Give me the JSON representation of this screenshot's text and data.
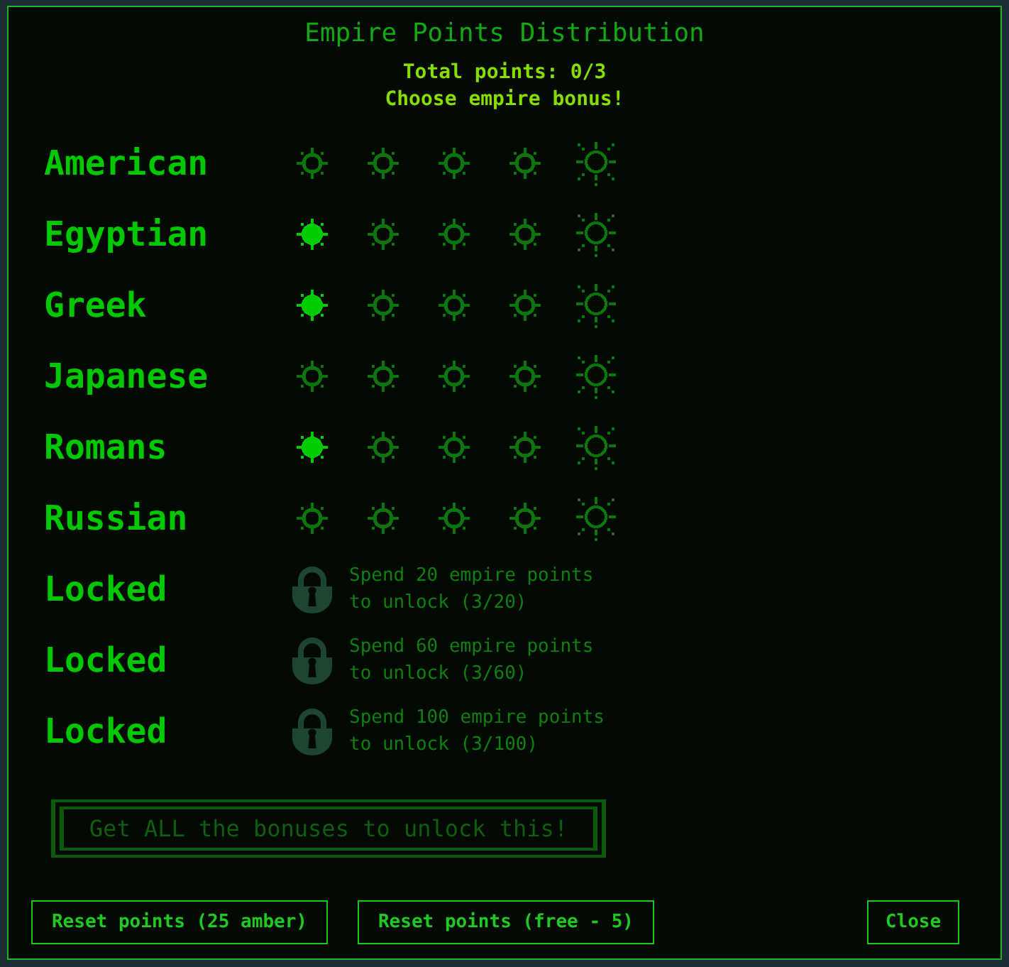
{
  "dialog": {
    "title": "Empire Points Distribution",
    "total_points": "Total points: 0/3",
    "prompt": "Choose empire bonus!"
  },
  "empires": [
    {
      "name": "American",
      "stars": 0
    },
    {
      "name": "Egyptian",
      "stars": 1
    },
    {
      "name": "Greek",
      "stars": 1
    },
    {
      "name": "Japanese",
      "stars": 0
    },
    {
      "name": "Romans",
      "stars": 1
    },
    {
      "name": "Russian",
      "stars": 0
    }
  ],
  "locked_slots": [
    {
      "label": "Locked",
      "requirement": "Spend 20 empire points to unlock (3/20)"
    },
    {
      "label": "Locked",
      "requirement": "Spend 60 empire points to unlock (3/60)"
    },
    {
      "label": "Locked",
      "requirement": "Spend 100 empire points to unlock (3/100)"
    }
  ],
  "bonus_banner": {
    "label": "Get ALL the bonuses to unlock this!",
    "disabled": true
  },
  "buttons": [
    {
      "label": "Reset points (25 amber)"
    },
    {
      "label": "Reset points (free - 5)"
    },
    {
      "label": "Close"
    }
  ]
}
